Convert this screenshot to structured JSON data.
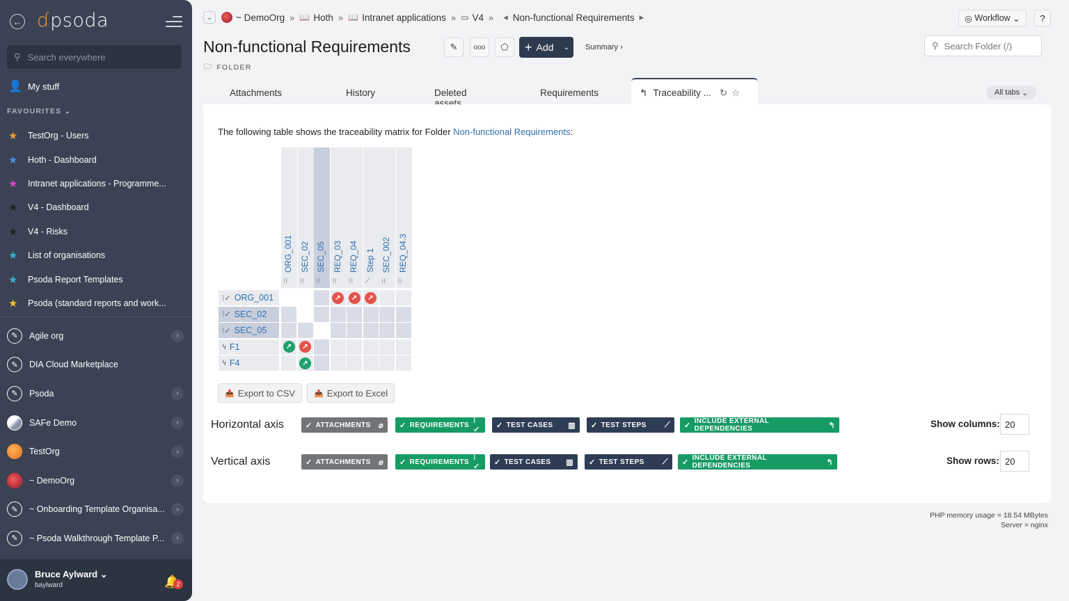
{
  "sidebar": {
    "logo": "psoda",
    "search_placeholder": "Search everywhere",
    "my_stuff": "My stuff",
    "favourites_header": "FAVOURITES",
    "favourites": [
      {
        "label": "TestOrg - Users",
        "color": "#f39b34"
      },
      {
        "label": "Hoth - Dashboard",
        "color": "#4a90e2"
      },
      {
        "label": "Intranet applications - Programme...",
        "color": "#d84ac6"
      },
      {
        "label": "V4 - Dashboard",
        "color": "#222222"
      },
      {
        "label": "V4 - Risks",
        "color": "#222222"
      },
      {
        "label": "List of organisations",
        "color": "#38b2c8"
      },
      {
        "label": "Psoda Report Templates",
        "color": "#38b2c8"
      },
      {
        "label": "Psoda (standard reports and work...",
        "color": "#f3c12c"
      }
    ],
    "orgs": [
      {
        "label": "Agile org",
        "chevron": true
      },
      {
        "label": "DIA Cloud Marketplace",
        "chevron": false
      },
      {
        "label": "Psoda",
        "chevron": true
      },
      {
        "label": "SAFe Demo",
        "chevron": true
      },
      {
        "label": "TestOrg",
        "chevron": true
      },
      {
        "label": "~ DemoOrg",
        "chevron": true
      },
      {
        "label": "~ Onboarding Template Organisa...",
        "chevron": true
      },
      {
        "label": "~ Psoda Walkthrough Template P...",
        "chevron": true
      }
    ],
    "user": {
      "name": "Bruce Aylward",
      "login": "baylward",
      "notifications": "2"
    }
  },
  "breadcrumbs": [
    "~ DemoOrg",
    "Hoth",
    "Intranet applications",
    "V4",
    "Non-functional Requirements"
  ],
  "header": {
    "workflow": "Workflow",
    "help": "?",
    "title": "Non-functional Requirements",
    "type": "FOLDER",
    "add": "Add",
    "summary": "Summary ›",
    "search_placeholder": "Search Folder (/)"
  },
  "tabs": [
    "Attachments",
    "History",
    "Deleted assets",
    "Requirements",
    "Traceability ..."
  ],
  "all_tabs": "All tabs",
  "content": {
    "intro_prefix": "The following table shows the traceability matrix for Folder ",
    "intro_link": "Non-functional Requirements",
    "intro_suffix": ":",
    "columns": [
      "ORG_001",
      "SEC_02",
      "SEC_05",
      "REQ_03",
      "REQ_04",
      "Step 1",
      "SEC_002",
      "REQ_04.3"
    ],
    "rows": [
      "ORG_001",
      "SEC_02",
      "SEC_05",
      "F1",
      "F4"
    ],
    "export_csv": "Export to CSV",
    "export_excel": "Export to Excel",
    "horizontal_axis": "Horizontal axis",
    "vertical_axis": "Vertical axis",
    "chips": [
      "ATTACHMENTS",
      "REQUIREMENTS",
      "TEST CASES",
      "TEST STEPS",
      "INCLUDE EXTERNAL DEPENDENCIES"
    ],
    "show_columns_label": "Show columns:",
    "show_columns_value": "20",
    "show_rows_label": "Show rows:",
    "show_rows_value": "20"
  },
  "footer": {
    "memory": "PHP memory usage = 18.54 MBytes",
    "server": "Server = nginx"
  }
}
